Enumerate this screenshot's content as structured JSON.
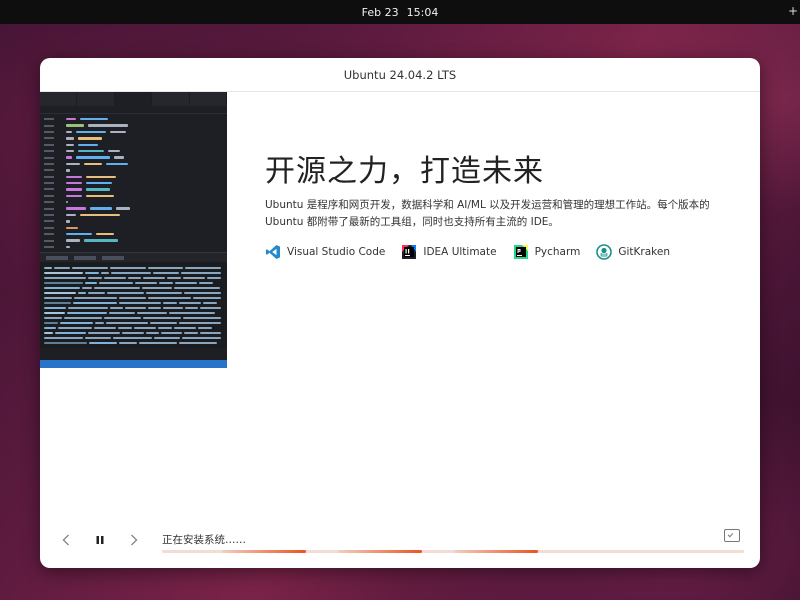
{
  "topbar": {
    "date": "Feb 23",
    "time": "15:04"
  },
  "window": {
    "title": "Ubuntu 24.04.2 LTS"
  },
  "slide": {
    "headline": "开源之力，打造未来",
    "description": "Ubuntu 是程序和网页开发，数据科学和 AI/ML 以及开发运营和管理的理想工作站。每个版本的 Ubuntu 都附带了最新的工具组，同时也支持所有主流的 IDE。",
    "tools": [
      {
        "label": "Visual Studio Code",
        "icon": "vscode-icon",
        "color": "#2489ca"
      },
      {
        "label": "IDEA Ultimate",
        "icon": "intellij-idea-icon",
        "color": "#000000"
      },
      {
        "label": "Pycharm",
        "icon": "pycharm-icon",
        "color": "#21d789"
      },
      {
        "label": "GitKraken",
        "icon": "gitkraken-icon",
        "color": "#179287"
      }
    ]
  },
  "installer": {
    "status": "正在安装系统……",
    "accent": "#e95420",
    "progress_segments": 3
  }
}
